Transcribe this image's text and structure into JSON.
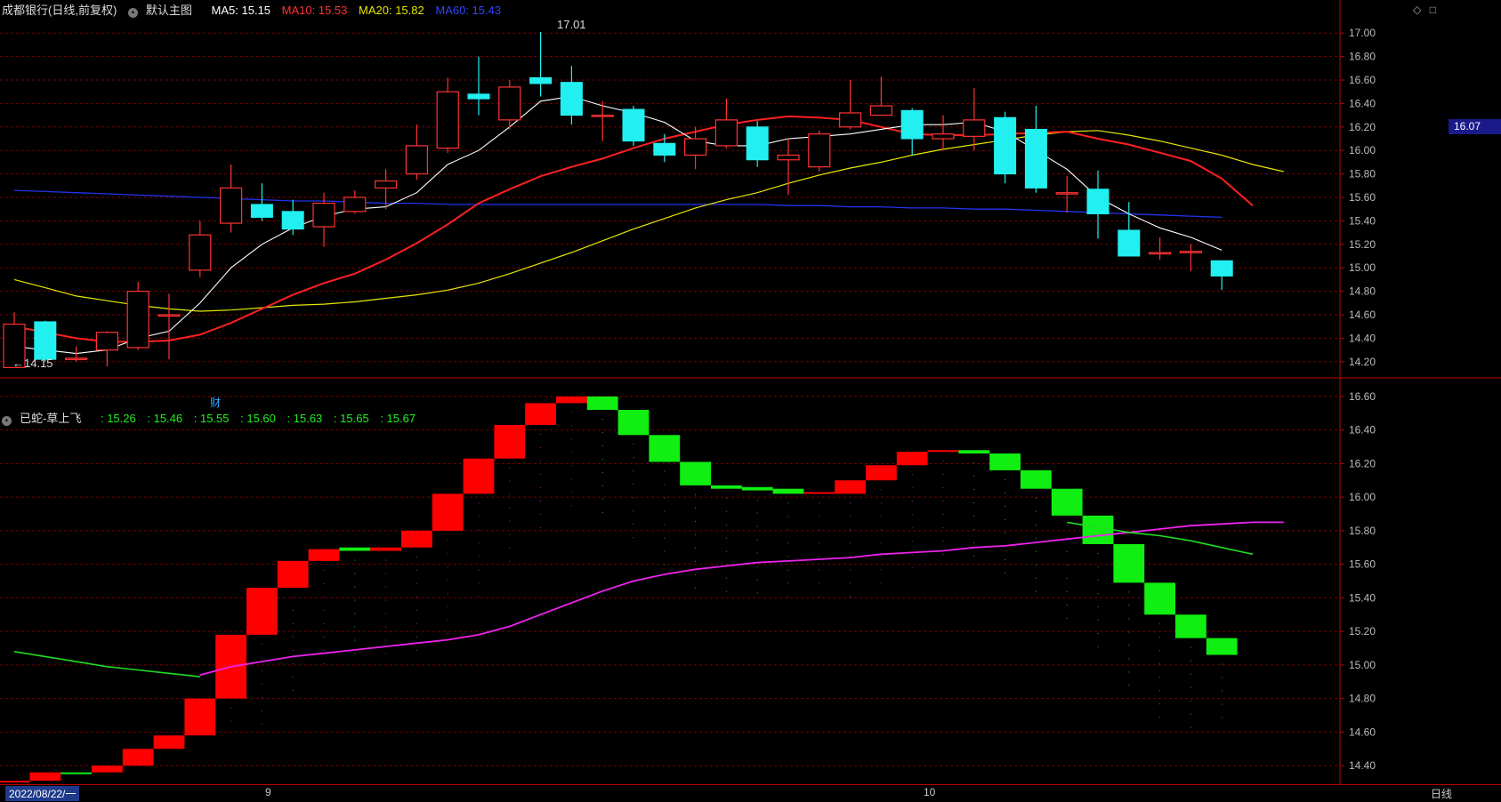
{
  "header_main": {
    "title": "成都银行(日线,前复权)",
    "label_main": "默认主图",
    "ma5": "MA5: 15.15",
    "ma10": "MA10: 15.53",
    "ma20": "MA20: 15.82",
    "ma60": "MA60: 15.43"
  },
  "header_sub": {
    "title": "已蛇-草上飞",
    "v1": ": 15.26",
    "v2": ": 15.46",
    "v3": ": 15.55",
    "v4": ": 15.60",
    "v5": ": 15.63",
    "v6": ": 15.65",
    "v7": ": 15.67"
  },
  "annotations": {
    "high": "17.01",
    "low": "←14.15",
    "finance_marker": "财",
    "current_price": "16.07"
  },
  "dates": {
    "start": "2022/08/22/一",
    "month_sep": "9",
    "month_oct": "10",
    "period": "日线"
  },
  "icons": [
    "diamond-icon",
    "square-icon"
  ],
  "colors": {
    "up": "#ff3333",
    "down": "#22f0f0",
    "ma5": "#ffffff",
    "ma10": "#ff2020",
    "ma20": "#e6e600",
    "ma60": "#2233ee",
    "block_up": "#ff0000",
    "block_down": "#11ee11",
    "sub_line": "#ee22ee"
  },
  "chart_data": [
    {
      "type": "candlestick",
      "title": "成都银行(日线,前复权)",
      "ylim": [
        14.1,
        17.1
      ],
      "yticks": [
        14.2,
        14.4,
        14.6,
        14.8,
        15.0,
        15.2,
        15.4,
        15.6,
        15.8,
        16.0,
        16.2,
        16.4,
        16.6,
        16.8,
        17.0
      ],
      "candles": [
        {
          "o": 14.15,
          "c": 14.52,
          "h": 14.62,
          "l": 14.15
        },
        {
          "o": 14.54,
          "c": 14.22,
          "h": 14.55,
          "l": 14.2
        },
        {
          "o": 14.23,
          "c": 14.23,
          "h": 14.33,
          "l": 14.2
        },
        {
          "o": 14.3,
          "c": 14.45,
          "h": 14.46,
          "l": 14.16
        },
        {
          "o": 14.32,
          "c": 14.8,
          "h": 14.88,
          "l": 14.3
        },
        {
          "o": 14.6,
          "c": 14.6,
          "h": 14.78,
          "l": 14.22
        },
        {
          "o": 14.98,
          "c": 15.28,
          "h": 15.4,
          "l": 14.92
        },
        {
          "o": 15.38,
          "c": 15.68,
          "h": 15.88,
          "l": 15.3
        },
        {
          "o": 15.54,
          "c": 15.43,
          "h": 15.72,
          "l": 15.4
        },
        {
          "o": 15.48,
          "c": 15.33,
          "h": 15.58,
          "l": 15.28
        },
        {
          "o": 15.35,
          "c": 15.55,
          "h": 15.64,
          "l": 15.18
        },
        {
          "o": 15.48,
          "c": 15.6,
          "h": 15.66,
          "l": 15.46
        },
        {
          "o": 15.68,
          "c": 15.74,
          "h": 15.84,
          "l": 15.5
        },
        {
          "o": 15.8,
          "c": 16.04,
          "h": 16.22,
          "l": 15.75
        },
        {
          "o": 16.02,
          "c": 16.5,
          "h": 16.62,
          "l": 15.98
        },
        {
          "o": 16.48,
          "c": 16.44,
          "h": 16.8,
          "l": 16.3
        },
        {
          "o": 16.26,
          "c": 16.54,
          "h": 16.6,
          "l": 16.18
        },
        {
          "o": 16.62,
          "c": 16.57,
          "h": 17.01,
          "l": 16.46
        },
        {
          "o": 16.58,
          "c": 16.3,
          "h": 16.72,
          "l": 16.22
        },
        {
          "o": 16.3,
          "c": 16.3,
          "h": 16.42,
          "l": 16.08
        },
        {
          "o": 16.35,
          "c": 16.08,
          "h": 16.38,
          "l": 16.04
        },
        {
          "o": 16.06,
          "c": 15.96,
          "h": 16.14,
          "l": 15.9
        },
        {
          "o": 15.96,
          "c": 16.1,
          "h": 16.2,
          "l": 15.84
        },
        {
          "o": 16.04,
          "c": 16.26,
          "h": 16.44,
          "l": 16.02
        },
        {
          "o": 16.2,
          "c": 15.92,
          "h": 16.25,
          "l": 15.86
        },
        {
          "o": 15.92,
          "c": 15.96,
          "h": 16.1,
          "l": 15.62
        },
        {
          "o": 15.86,
          "c": 16.14,
          "h": 16.17,
          "l": 15.82
        },
        {
          "o": 16.2,
          "c": 16.32,
          "h": 16.6,
          "l": 16.18
        },
        {
          "o": 16.3,
          "c": 16.38,
          "h": 16.63,
          "l": 16.3
        },
        {
          "o": 16.34,
          "c": 16.1,
          "h": 16.36,
          "l": 15.96
        },
        {
          "o": 16.1,
          "c": 16.14,
          "h": 16.3,
          "l": 16.0
        },
        {
          "o": 16.12,
          "c": 16.26,
          "h": 16.53,
          "l": 16.0
        },
        {
          "o": 16.28,
          "c": 15.8,
          "h": 16.33,
          "l": 15.72
        },
        {
          "o": 16.18,
          "c": 15.68,
          "h": 16.38,
          "l": 15.64
        },
        {
          "o": 15.64,
          "c": 15.64,
          "h": 15.78,
          "l": 15.47
        },
        {
          "o": 15.67,
          "c": 15.46,
          "h": 15.83,
          "l": 15.25
        },
        {
          "o": 15.32,
          "c": 15.1,
          "h": 15.56,
          "l": 15.1
        },
        {
          "o": 15.12,
          "c": 15.13,
          "h": 15.26,
          "l": 15.07
        },
        {
          "o": 15.14,
          "c": 15.14,
          "h": 15.2,
          "l": 14.97
        },
        {
          "o": 15.06,
          "c": 14.93,
          "h": 15.06,
          "l": 14.81
        }
      ],
      "ma": {
        "MA5": [
          14.33,
          14.3,
          14.27,
          14.3,
          14.4,
          14.46,
          14.7,
          15.0,
          15.2,
          15.34,
          15.44,
          15.5,
          15.52,
          15.64,
          15.88,
          16.0,
          16.2,
          16.42,
          16.46,
          16.38,
          16.32,
          16.24,
          16.08,
          16.04,
          16.04,
          16.1,
          16.12,
          16.14,
          16.18,
          16.22,
          16.22,
          16.24,
          16.16,
          16.0,
          15.84,
          15.6,
          15.46,
          15.34,
          15.26,
          15.15
        ],
        "MA10": [
          14.5,
          14.45,
          14.4,
          14.37,
          14.37,
          14.38,
          14.43,
          14.53,
          14.65,
          14.77,
          14.87,
          14.95,
          15.07,
          15.21,
          15.37,
          15.55,
          15.67,
          15.78,
          15.86,
          15.93,
          16.02,
          16.1,
          16.16,
          16.22,
          16.26,
          16.29,
          16.28,
          16.26,
          16.2,
          16.14,
          16.13,
          16.13,
          16.14,
          16.15,
          16.16,
          16.1,
          16.05,
          15.98,
          15.91,
          15.76,
          15.53
        ],
        "MA20": [
          14.9,
          14.83,
          14.76,
          14.72,
          14.68,
          14.65,
          14.63,
          14.64,
          14.66,
          14.68,
          14.69,
          14.71,
          14.74,
          14.77,
          14.81,
          14.87,
          14.95,
          15.04,
          15.13,
          15.23,
          15.33,
          15.42,
          15.51,
          15.58,
          15.64,
          15.72,
          15.79,
          15.85,
          15.9,
          15.96,
          16.01,
          16.05,
          16.09,
          16.13,
          16.16,
          16.17,
          16.13,
          16.08,
          16.02,
          15.96,
          15.88,
          15.82
        ],
        "MA60": [
          15.66,
          15.65,
          15.64,
          15.63,
          15.62,
          15.61,
          15.6,
          15.59,
          15.58,
          15.57,
          15.57,
          15.56,
          15.55,
          15.55,
          15.54,
          15.54,
          15.54,
          15.54,
          15.54,
          15.54,
          15.54,
          15.54,
          15.54,
          15.54,
          15.54,
          15.53,
          15.53,
          15.52,
          15.52,
          15.51,
          15.51,
          15.5,
          15.5,
          15.49,
          15.48,
          15.47,
          15.46,
          15.45,
          15.44,
          15.43
        ]
      }
    },
    {
      "type": "bar",
      "title": "已蛇-草上飞",
      "ylim": [
        14.3,
        16.7
      ],
      "yticks": [
        14.4,
        14.6,
        14.8,
        15.0,
        15.2,
        15.4,
        15.6,
        15.8,
        16.0,
        16.2,
        16.4,
        16.6
      ],
      "blocks": [
        {
          "lo": 14.3,
          "hi": 14.31,
          "up": true
        },
        {
          "lo": 14.31,
          "hi": 14.36,
          "up": true
        },
        {
          "lo": 14.35,
          "hi": 14.36,
          "up": false
        },
        {
          "lo": 14.36,
          "hi": 14.4,
          "up": true
        },
        {
          "lo": 14.4,
          "hi": 14.5,
          "up": true
        },
        {
          "lo": 14.5,
          "hi": 14.58,
          "up": true
        },
        {
          "lo": 14.58,
          "hi": 14.8,
          "up": true
        },
        {
          "lo": 14.8,
          "hi": 15.18,
          "up": true
        },
        {
          "lo": 15.18,
          "hi": 15.46,
          "up": true
        },
        {
          "lo": 15.46,
          "hi": 15.62,
          "up": true
        },
        {
          "lo": 15.62,
          "hi": 15.69,
          "up": true
        },
        {
          "lo": 15.68,
          "hi": 15.7,
          "up": false
        },
        {
          "lo": 15.68,
          "hi": 15.7,
          "up": true
        },
        {
          "lo": 15.7,
          "hi": 15.8,
          "up": true
        },
        {
          "lo": 15.8,
          "hi": 16.02,
          "up": true
        },
        {
          "lo": 16.02,
          "hi": 16.23,
          "up": true
        },
        {
          "lo": 16.23,
          "hi": 16.43,
          "up": true
        },
        {
          "lo": 16.43,
          "hi": 16.56,
          "up": true
        },
        {
          "lo": 16.56,
          "hi": 16.6,
          "up": true
        },
        {
          "lo": 16.52,
          "hi": 16.6,
          "up": false
        },
        {
          "lo": 16.37,
          "hi": 16.52,
          "up": false
        },
        {
          "lo": 16.21,
          "hi": 16.37,
          "up": false
        },
        {
          "lo": 16.07,
          "hi": 16.21,
          "up": false
        },
        {
          "lo": 16.05,
          "hi": 16.07,
          "up": false
        },
        {
          "lo": 16.04,
          "hi": 16.06,
          "up": false
        },
        {
          "lo": 16.02,
          "hi": 16.05,
          "up": false
        },
        {
          "lo": 16.02,
          "hi": 16.03,
          "up": true
        },
        {
          "lo": 16.02,
          "hi": 16.1,
          "up": true
        },
        {
          "lo": 16.1,
          "hi": 16.19,
          "up": true
        },
        {
          "lo": 16.19,
          "hi": 16.27,
          "up": true
        },
        {
          "lo": 16.27,
          "hi": 16.28,
          "up": true
        },
        {
          "lo": 16.26,
          "hi": 16.28,
          "up": false
        },
        {
          "lo": 16.16,
          "hi": 16.26,
          "up": false
        },
        {
          "lo": 16.05,
          "hi": 16.16,
          "up": false
        },
        {
          "lo": 15.89,
          "hi": 16.05,
          "up": false
        },
        {
          "lo": 15.72,
          "hi": 15.89,
          "up": false
        },
        {
          "lo": 15.49,
          "hi": 15.72,
          "up": false
        },
        {
          "lo": 15.3,
          "hi": 15.49,
          "up": false
        },
        {
          "lo": 15.16,
          "hi": 15.3,
          "up": false
        },
        {
          "lo": 15.06,
          "hi": 15.16,
          "up": false
        }
      ],
      "line_green_a": [
        15.08,
        15.05,
        15.02,
        14.99,
        14.97,
        14.95,
        14.93
      ],
      "line_magenta": [
        14.94,
        14.99,
        15.02,
        15.05,
        15.07,
        15.09,
        15.11,
        15.13,
        15.15,
        15.18,
        15.23,
        15.3,
        15.37,
        15.44,
        15.5,
        15.54,
        15.57,
        15.59,
        15.61,
        15.62,
        15.63,
        15.64,
        15.66,
        15.67,
        15.68,
        15.7,
        15.71,
        15.73,
        15.75,
        15.77,
        15.79,
        15.81,
        15.83,
        15.84,
        15.85,
        15.85
      ],
      "line_green_b": [
        15.85,
        15.82,
        15.79,
        15.77,
        15.74,
        15.7,
        15.66
      ]
    }
  ]
}
